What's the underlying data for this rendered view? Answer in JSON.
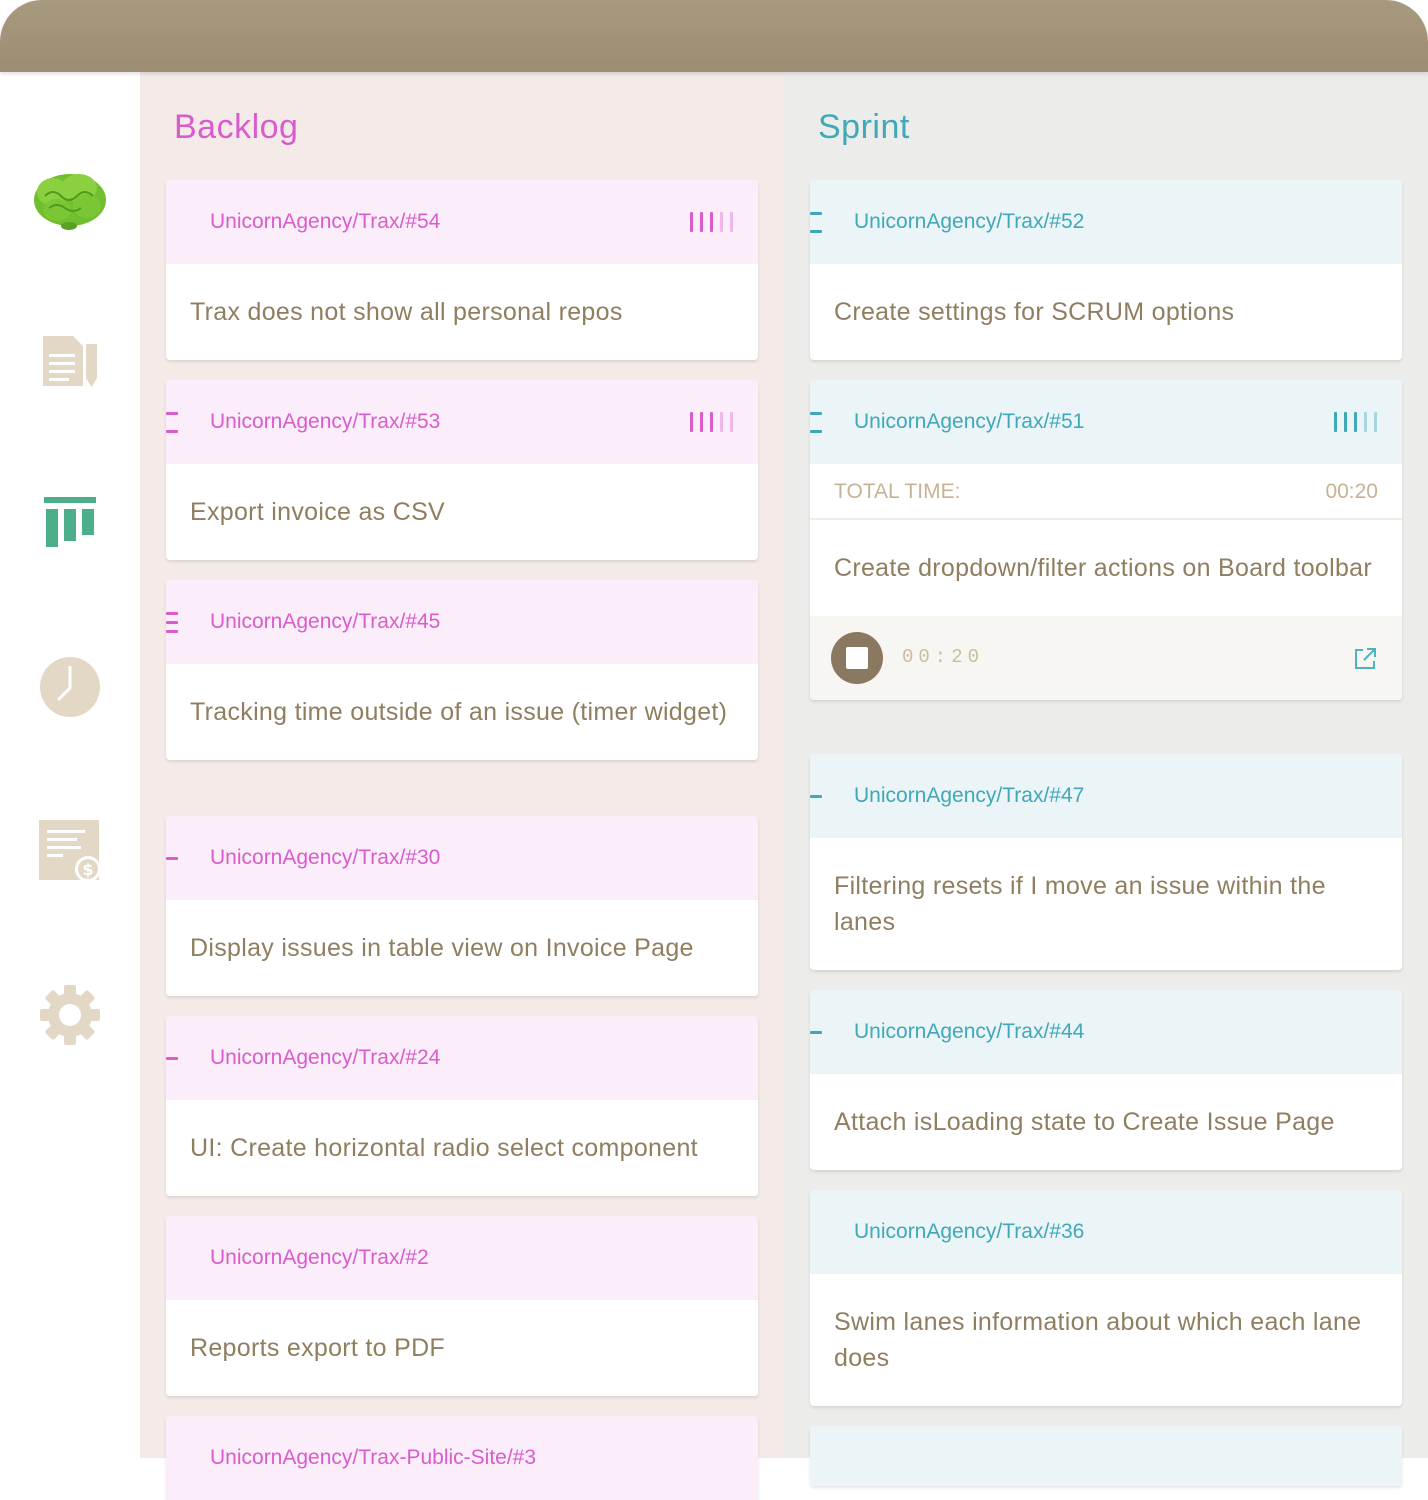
{
  "backlog": {
    "title": "Backlog",
    "cards": [
      {
        "id": "UnicornAgency/Trax/#54",
        "title": "Trax does not show all personal repos"
      },
      {
        "id": "UnicornAgency/Trax/#53",
        "title": "Export invoice as CSV"
      },
      {
        "id": "UnicornAgency/Trax/#45",
        "title": "Tracking time outside of an issue (timer widget)"
      },
      {
        "id": "UnicornAgency/Trax/#30",
        "title": "Display issues in table view on Invoice Page"
      },
      {
        "id": "UnicornAgency/Trax/#24",
        "title": "UI: Create horizontal radio select component"
      },
      {
        "id": "UnicornAgency/Trax/#2",
        "title": "Reports export to PDF"
      },
      {
        "id": "UnicornAgency/Trax-Public-Site/#3",
        "title": ""
      }
    ]
  },
  "sprint": {
    "title": "Sprint",
    "cards": [
      {
        "id": "UnicornAgency/Trax/#52",
        "title": "Create settings for SCRUM options"
      },
      {
        "id": "UnicornAgency/Trax/#51",
        "title": "Create dropdown/filter actions on Board toolbar",
        "total_time_label": "TOTAL TIME:",
        "total_time": "00:20",
        "timer": "00:20"
      },
      {
        "id": "UnicornAgency/Trax/#47",
        "title": "Filtering resets if I move an issue within the lanes"
      },
      {
        "id": "UnicornAgency/Trax/#44",
        "title": "Attach isLoading state to Create Issue Page"
      },
      {
        "id": "UnicornAgency/Trax/#36",
        "title": "Swim lanes information about which each lane does"
      }
    ]
  },
  "sidebar": {
    "items": [
      {
        "icon": "brain-logo-icon"
      },
      {
        "icon": "issues-document-icon"
      },
      {
        "icon": "board-icon"
      },
      {
        "icon": "clock-icon"
      },
      {
        "icon": "invoice-icon"
      },
      {
        "icon": "settings-gear-icon"
      }
    ]
  },
  "colors": {
    "topbar": "#9d8d72",
    "backlog_accent": "#d95ccd",
    "sprint_accent": "#3fa8b9",
    "text": "#8f7e5f",
    "icon_muted": "#e3d8c5",
    "icon_active": "#4caf8a"
  }
}
